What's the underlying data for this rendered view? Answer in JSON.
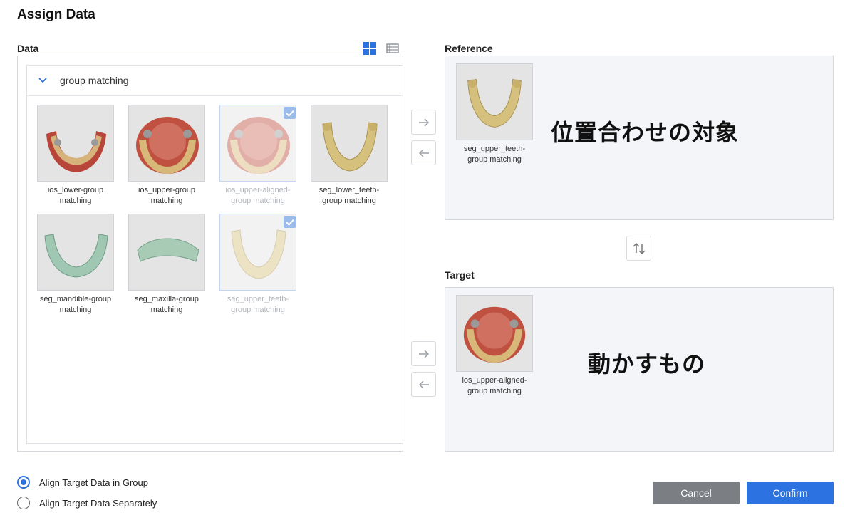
{
  "dialog": {
    "title": "Assign Data"
  },
  "data_panel": {
    "label": "Data",
    "group": {
      "name": "group matching",
      "items": [
        {
          "label": "ios_lower-group matching",
          "selected": false,
          "thumb": "lower-jaw-scan"
        },
        {
          "label": "ios_upper-group matching",
          "selected": false,
          "thumb": "upper-jaw-scan"
        },
        {
          "label": "ios_upper-aligned-group matching",
          "selected": true,
          "thumb": "upper-jaw-scan"
        },
        {
          "label": "seg_lower_teeth-group matching",
          "selected": false,
          "thumb": "lower-teeth-segment"
        },
        {
          "label": "seg_mandible-group matching",
          "selected": false,
          "thumb": "mandible-segment"
        },
        {
          "label": "seg_maxilla-group matching",
          "selected": false,
          "thumb": "maxilla-segment"
        },
        {
          "label": "seg_upper_teeth-group matching",
          "selected": true,
          "thumb": "upper-teeth-segment"
        }
      ]
    }
  },
  "reference": {
    "label": "Reference",
    "item_label": "seg_upper_teeth-group matching",
    "note": "位置合わせの対象"
  },
  "target": {
    "label": "Target",
    "item_label": "ios_upper-aligned-group matching",
    "note": "動かすもの"
  },
  "options": {
    "group": "Align Target Data in Group",
    "separate": "Align Target Data Separately",
    "selected": "group"
  },
  "buttons": {
    "cancel": "Cancel",
    "confirm": "Confirm"
  },
  "colors": {
    "accent": "#2c72e0",
    "cancel": "#7b7f84",
    "panel_bg": "#f3f5f9"
  },
  "icons": [
    "grid-view-icon",
    "list-view-icon",
    "chevron-down-icon",
    "arrow-right-icon",
    "arrow-left-icon",
    "swap-vertical-icon",
    "check-icon"
  ]
}
